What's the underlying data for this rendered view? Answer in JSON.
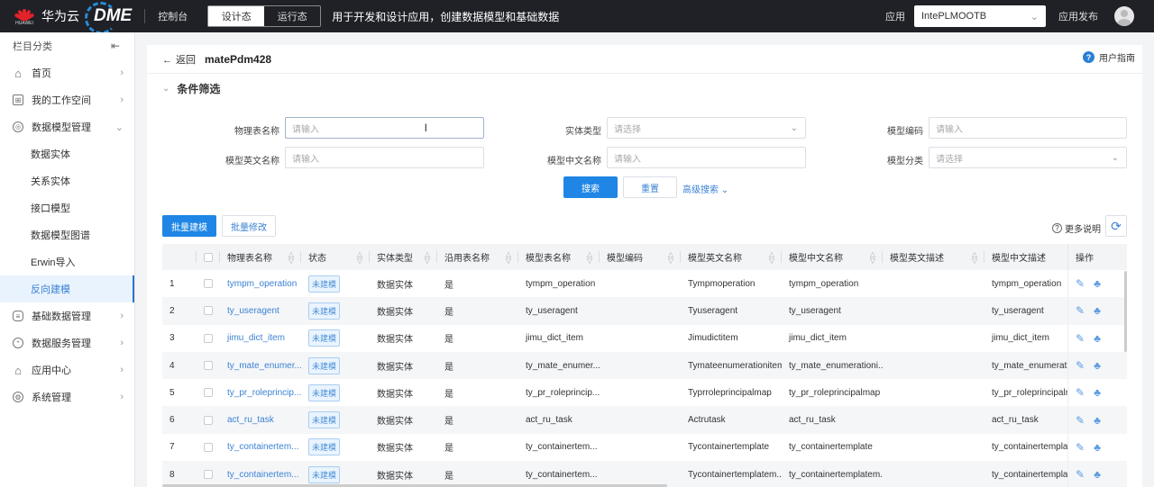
{
  "topbar": {
    "brand": "华为云",
    "huawei_text": "HUAWEI",
    "product": "DME",
    "console": "控制台",
    "modes": [
      "设计态",
      "运行态"
    ],
    "active_mode": "设计态",
    "description": "用于开发和设计应用，创建数据模型和基础数据",
    "app_label": "应用",
    "app_value": "IntePLMOOTB",
    "publish": "应用发布"
  },
  "sidebar": {
    "title": "栏目分类",
    "items": [
      {
        "label": "首页",
        "icon": "home-icon",
        "expanded": false
      },
      {
        "label": "我的工作空间",
        "icon": "workspace-icon",
        "expanded": false
      },
      {
        "label": "数据模型管理",
        "icon": "data-model-icon",
        "expanded": true,
        "children": [
          "数据实体",
          "关系实体",
          "接口模型",
          "数据模型图谱",
          "Erwin导入",
          "反向建模"
        ]
      },
      {
        "label": "基础数据管理",
        "icon": "database-icon",
        "expanded": false
      },
      {
        "label": "数据服务管理",
        "icon": "api-icon",
        "expanded": false
      },
      {
        "label": "应用中心",
        "icon": "app-center-icon",
        "expanded": false
      },
      {
        "label": "系统管理",
        "icon": "settings-icon",
        "expanded": false
      }
    ],
    "active_child": "反向建模"
  },
  "page": {
    "back": "返回",
    "title": "matePdm428",
    "guide": "用户指南",
    "filter_title": "条件筛选",
    "filters": {
      "physical_table_name": {
        "label": "物理表名称",
        "placeholder": "请输入"
      },
      "entity_type": {
        "label": "实体类型",
        "placeholder": "请选择"
      },
      "model_code": {
        "label": "模型编码",
        "placeholder": "请输入"
      },
      "model_en_name": {
        "label": "模型英文名称",
        "placeholder": "请输入"
      },
      "model_cn_name": {
        "label": "模型中文名称",
        "placeholder": "请输入"
      },
      "model_category": {
        "label": "模型分类",
        "placeholder": "请选择"
      }
    },
    "search": "搜索",
    "reset": "重置",
    "advanced": "高级搜索",
    "batch_build": "批量建模",
    "batch_edit": "批量修改",
    "more_info": "更多说明"
  },
  "table": {
    "columns": [
      "物理表名称",
      "状态",
      "实体类型",
      "沿用表名称",
      "模型表名称",
      "模型编码",
      "模型英文名称",
      "模型中文名称",
      "模型英文描述",
      "模型中文描述",
      "操作"
    ],
    "rows": [
      {
        "no": "1",
        "physical": "tympm_operation",
        "status": "未建模",
        "type": "数据实体",
        "reuse": "是",
        "model_table": "tympm_operation",
        "code": "",
        "en_name": "Tympmoperation",
        "cn_name": "tympm_operation",
        "en_desc": "",
        "cn_desc": "tympm_operation"
      },
      {
        "no": "2",
        "physical": "ty_useragent",
        "status": "未建模",
        "type": "数据实体",
        "reuse": "是",
        "model_table": "ty_useragent",
        "code": "",
        "en_name": "Tyuseragent",
        "cn_name": "ty_useragent",
        "en_desc": "",
        "cn_desc": "ty_useragent"
      },
      {
        "no": "3",
        "physical": "jimu_dict_item",
        "status": "未建模",
        "type": "数据实体",
        "reuse": "是",
        "model_table": "jimu_dict_item",
        "code": "",
        "en_name": "Jimudictitem",
        "cn_name": "jimu_dict_item",
        "en_desc": "",
        "cn_desc": "jimu_dict_item"
      },
      {
        "no": "4",
        "physical": "ty_mate_enumer...",
        "status": "未建模",
        "type": "数据实体",
        "reuse": "是",
        "model_table": "ty_mate_enumer...",
        "code": "",
        "en_name": "Tymateenumerationitem",
        "cn_name": "ty_mate_enumerationi...",
        "en_desc": "",
        "cn_desc": "ty_mate_enumeration"
      },
      {
        "no": "5",
        "physical": "ty_pr_roleprincip...",
        "status": "未建模",
        "type": "数据实体",
        "reuse": "是",
        "model_table": "ty_pr_roleprincip...",
        "code": "",
        "en_name": "Typrroleprincipalmap",
        "cn_name": "ty_pr_roleprincipalmap",
        "en_desc": "",
        "cn_desc": "ty_pr_roleprincipalma"
      },
      {
        "no": "6",
        "physical": "act_ru_task",
        "status": "未建模",
        "type": "数据实体",
        "reuse": "是",
        "model_table": "act_ru_task",
        "code": "",
        "en_name": "Actrutask",
        "cn_name": "act_ru_task",
        "en_desc": "",
        "cn_desc": "act_ru_task"
      },
      {
        "no": "7",
        "physical": "ty_containertem...",
        "status": "未建模",
        "type": "数据实体",
        "reuse": "是",
        "model_table": "ty_containertem...",
        "code": "",
        "en_name": "Tycontainertemplate",
        "cn_name": "ty_containertemplate",
        "en_desc": "",
        "cn_desc": "ty_containertemplate"
      },
      {
        "no": "8",
        "physical": "ty_containertem...",
        "status": "未建模",
        "type": "数据实体",
        "reuse": "是",
        "model_table": "ty_containertem...",
        "code": "",
        "en_name": "Tycontainertemplatem...",
        "cn_name": "ty_containertemplatem...",
        "en_desc": "",
        "cn_desc": "ty_containertemplater"
      }
    ]
  }
}
